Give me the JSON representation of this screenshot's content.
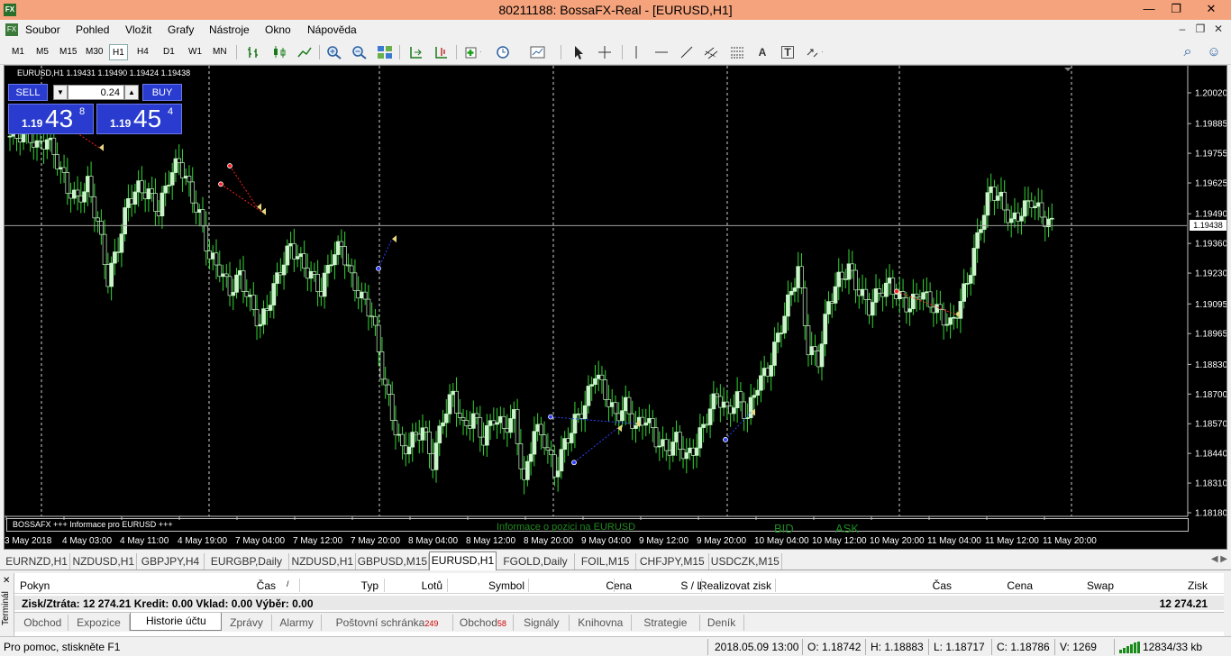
{
  "window": {
    "title": "80211188: BossaFX-Real - [EURUSD,H1]",
    "minimize": "—",
    "restore": "❐",
    "close": "✕",
    "app_icon": "FX"
  },
  "menu": {
    "items": [
      "Soubor",
      "Pohled",
      "Vložit",
      "Grafy",
      "Nástroje",
      "Okno",
      "Nápověda"
    ],
    "mdi_minimize": "–",
    "mdi_restore": "❐",
    "mdi_close": "✕"
  },
  "toolbar": {
    "timeframes": [
      "M1",
      "M5",
      "M15",
      "M30",
      "H1",
      "H4",
      "D1",
      "W1",
      "MN"
    ],
    "active_timeframe": "H1",
    "icons": [
      "bar-chart-icon",
      "candlestick-icon",
      "line-chart-icon",
      "zoom-in-icon",
      "zoom-out-icon",
      "tile-windows-icon",
      "autoscroll-icon",
      "chart-shift-icon",
      "indicators-icon",
      "periods-icon",
      "templates-icon",
      "cursor-icon",
      "crosshair-icon",
      "vertical-line-icon",
      "horizontal-line-icon",
      "trendline-icon",
      "equidistant-channel-icon",
      "fibonacci-icon",
      "text-icon",
      "text-label-icon",
      "arrows-icon"
    ],
    "text_a": "A",
    "text_t": "T",
    "search_icon": "⌕",
    "account_icon": "☺"
  },
  "chart": {
    "header": "EURUSD,H1  1.19431 1.19490 1.19424 1.19438",
    "current_price": "1.19438",
    "news_bar": "BOSSAFX +++ Informace pro EURUSD +++",
    "news_ghost": "Informace o pozici na EURUSD",
    "bid_ghost": "BID",
    "ask_ghost": "ASK"
  },
  "one_click": {
    "sell_label": "SELL",
    "buy_label": "BUY",
    "lot": "0.24",
    "lot_down": "▼",
    "lot_up": "▲",
    "sell_price_small": "1.19",
    "sell_price_big": "43",
    "sell_price_sup": "8",
    "buy_price_small": "1.19",
    "buy_price_big": "45",
    "buy_price_sup": "4"
  },
  "chart_data": {
    "type": "candlestick",
    "symbol": "EURUSD",
    "timeframe": "H1",
    "ylim": [
      1.1818,
      1.2002
    ],
    "price_ticks": [
      "1.20020",
      "1.19885",
      "1.19755",
      "1.19625",
      "1.19490",
      "1.19360",
      "1.19230",
      "1.19095",
      "1.18965",
      "1.18830",
      "1.18700",
      "1.18570",
      "1.18440",
      "1.18310",
      "1.18180"
    ],
    "time_ticks": [
      "3 May 2018",
      "4 May 03:00",
      "4 May 11:00",
      "4 May 19:00",
      "7 May 04:00",
      "7 May 12:00",
      "7 May 20:00",
      "8 May 04:00",
      "8 May 12:00",
      "8 May 20:00",
      "9 May 04:00",
      "9 May 12:00",
      "9 May 20:00",
      "10 May 04:00",
      "10 May 12:00",
      "10 May 20:00",
      "11 May 04:00",
      "11 May 12:00",
      "11 May 20:00"
    ],
    "close_path": [
      1.1983,
      1.1985,
      1.1978,
      1.1982,
      1.1972,
      1.196,
      1.1955,
      1.1962,
      1.1945,
      1.192,
      1.1935,
      1.1955,
      1.196,
      1.1958,
      1.195,
      1.1965,
      1.1972,
      1.196,
      1.1948,
      1.193,
      1.1925,
      1.1915,
      1.1922,
      1.191,
      1.19,
      1.1912,
      1.1925,
      1.1935,
      1.1928,
      1.1922,
      1.1915,
      1.193,
      1.1935,
      1.192,
      1.1912,
      1.1905,
      1.188,
      1.186,
      1.1845,
      1.185,
      1.1855,
      1.184,
      1.186,
      1.187,
      1.1855,
      1.186,
      1.185,
      1.186,
      1.1855,
      1.186,
      1.183,
      1.1855,
      1.185,
      1.1835,
      1.1848,
      1.1858,
      1.1865,
      1.188,
      1.187,
      1.186,
      1.1865,
      1.1855,
      1.186,
      1.185,
      1.1845,
      1.185,
      1.1842,
      1.1848,
      1.186,
      1.187,
      1.1862,
      1.1868,
      1.186,
      1.1875,
      1.188,
      1.1895,
      1.191,
      1.1925,
      1.189,
      1.1885,
      1.191,
      1.192,
      1.1925,
      1.1915,
      1.1908,
      1.1915,
      1.1918,
      1.1912,
      1.1908,
      1.1915,
      1.191,
      1.1905,
      1.19,
      1.191,
      1.1925,
      1.1945,
      1.196,
      1.1955,
      1.1945,
      1.195,
      1.1955,
      1.1948,
      1.1944
    ]
  },
  "chart_tabs": [
    "EURNZD,H1",
    "NZDUSD,H1",
    "GBPJPY,H4",
    "EURGBP,Daily",
    "NZDUSD,H1",
    "GBPUSD,M15",
    "EURUSD,H1",
    "FGOLD,Daily",
    "FOIL,M15",
    "CHFJPY,M15",
    "USDCZK,M15"
  ],
  "active_chart_tab": 6,
  "terminal": {
    "label": "Terminál",
    "close": "✕",
    "columns": [
      "Pokyn",
      "Čas",
      "Typ",
      "Lotů",
      "Symbol",
      "Cena",
      "S / L",
      "Realizovat zisk",
      "Čas",
      "Cena",
      "Swap",
      "Zisk"
    ],
    "sort_marker": "/",
    "summary": "Zisk/Ztráta: 12 274.21  Kredit: 0.00  Vklad: 0.00  Výběr: 0.00",
    "summary_total": "12 274.21",
    "tabs": [
      {
        "label": "Obchod",
        "badge": ""
      },
      {
        "label": "Expozice",
        "badge": ""
      },
      {
        "label": "Historie účtu",
        "badge": ""
      },
      {
        "label": "Zprávy",
        "badge": ""
      },
      {
        "label": "Alarmy",
        "badge": ""
      },
      {
        "label": "Poštovní schránka",
        "badge": "249"
      },
      {
        "label": "Obchod",
        "badge": "58"
      },
      {
        "label": "Signály",
        "badge": ""
      },
      {
        "label": "Knihovna",
        "badge": ""
      },
      {
        "label": "Strategie",
        "badge": ""
      },
      {
        "label": "Deník",
        "badge": ""
      }
    ],
    "active_tab": 2
  },
  "status": {
    "help": "Pro pomoc, stiskněte F1",
    "datetime": "2018.05.09 13:00",
    "open": "O: 1.18742",
    "high": "H: 1.18883",
    "low": "L: 1.18717",
    "close": "C: 1.18786",
    "volume": "V: 1269",
    "traffic": "12834/33 kb"
  },
  "colors": {
    "title_bar": "#f5a37c",
    "chart_bg": "#000000",
    "candle": "#c8f5c8",
    "wick": "#32d632",
    "button_blue": "#2a3ccf"
  }
}
